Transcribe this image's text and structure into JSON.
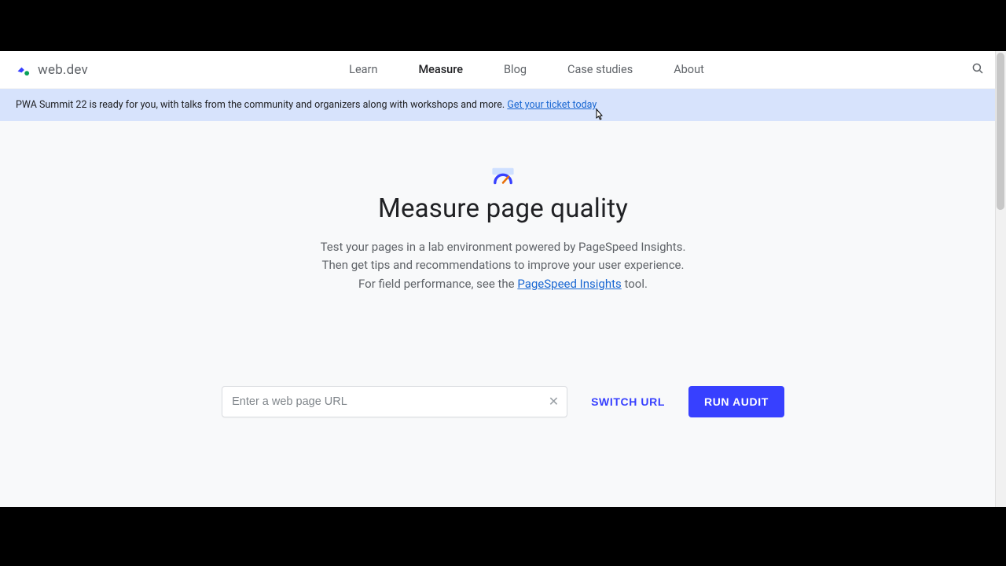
{
  "brand": {
    "name": "web.dev"
  },
  "nav": {
    "items": [
      {
        "label": "Learn"
      },
      {
        "label": "Measure",
        "active": true
      },
      {
        "label": "Blog"
      },
      {
        "label": "Case studies"
      },
      {
        "label": "About"
      }
    ]
  },
  "banner": {
    "text": "PWA Summit 22 is ready for you, with talks from the community and organizers along with workshops and more. ",
    "link_text": "Get your ticket today"
  },
  "hero": {
    "title": "Measure page quality",
    "desc_before": "Test your pages in a lab environment powered by PageSpeed Insights. Then get tips and recommendations to improve your user experience. For field performance, see the ",
    "link_text": "PageSpeed Insights",
    "desc_after": " tool."
  },
  "url_form": {
    "placeholder": "Enter a web page URL",
    "value": "",
    "switch_label": "SWITCH URL",
    "run_label": "RUN AUDIT"
  }
}
